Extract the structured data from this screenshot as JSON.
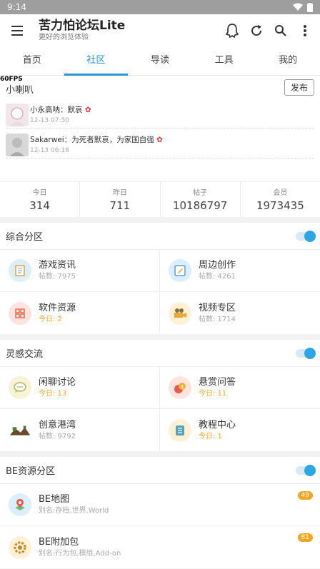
{
  "status": {
    "time": "9:14"
  },
  "appbar": {
    "title": "苦力怕论坛Lite",
    "subtitle": "更好的浏览体验",
    "actions": [
      "ghost-icon",
      "refresh-icon",
      "search-icon",
      "more-vert-icon"
    ]
  },
  "tabs": [
    {
      "label": "首页",
      "active": false
    },
    {
      "label": "社区",
      "active": true
    },
    {
      "label": "导读",
      "active": false
    },
    {
      "label": "工具",
      "active": false
    },
    {
      "label": "我的",
      "active": false
    }
  ],
  "chat": {
    "fps": "60FPS",
    "title": "小喇叭",
    "post_label": "发布",
    "messages": [
      {
        "text": "小永高呐：默哀",
        "time": "12-13 07:50"
      },
      {
        "text": "Sakarwei：为死者默哀，为家国自强",
        "time": "12-13 06:18"
      }
    ]
  },
  "stats": [
    {
      "label": "今日",
      "value": "314"
    },
    {
      "label": "昨日",
      "value": "711"
    },
    {
      "label": "帖子",
      "value": "10186797"
    },
    {
      "label": "会员",
      "value": "1973435"
    }
  ],
  "sections": {
    "general": {
      "title": "综合分区",
      "forums": [
        {
          "name": "游戏资讯",
          "sub": "帖数: 7975",
          "icon": "document-icon"
        },
        {
          "name": "周边创作",
          "sub": "帖数: 4261",
          "icon": "pencil-icon"
        },
        {
          "name": "软件资源",
          "sub": "今日: 2",
          "icon": "apps-icon"
        },
        {
          "name": "视频专区",
          "sub": "帖数: 1714",
          "icon": "video-camera-icon"
        }
      ]
    },
    "inspiration": {
      "title": "灵感交流",
      "forums": [
        {
          "name": "闲聊讨论",
          "sub": "今日: 13",
          "icon": "chat-bubble-icon"
        },
        {
          "name": "悬赏问答",
          "sub": "今日: 11",
          "icon": "coins-icon"
        },
        {
          "name": "创意港湾",
          "sub": "帖数: 9792",
          "icon": "island-icon"
        },
        {
          "name": "教程中心",
          "sub": "今日: 1",
          "icon": "book-icon"
        }
      ]
    },
    "be": {
      "title": "BE资源分区",
      "rows": [
        {
          "name": "BE地图",
          "alias": "别名:存档,世界,World",
          "badge": "49",
          "icon": "map-pin-icon"
        },
        {
          "name": "BE附加包",
          "alias": "别名:行为包,模组,Add-on",
          "badge": "81",
          "icon": "gear-icon"
        }
      ]
    }
  }
}
